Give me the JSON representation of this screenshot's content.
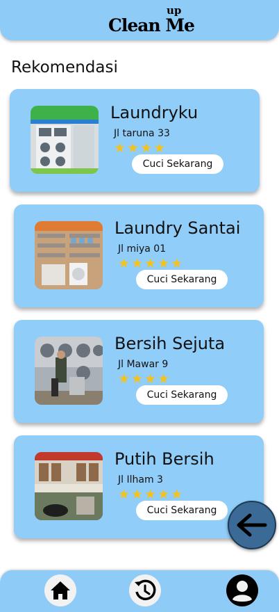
{
  "header": {
    "logo_main": "Clean Me",
    "logo_sup": "up"
  },
  "section_title": "Rekomendasi",
  "cta_label": "Cuci Sekarang",
  "colors": {
    "card": "#90cdf8",
    "header": "#8ecbf7",
    "star": "#f3c21f",
    "fab": "#3a6a95"
  },
  "laundries": [
    {
      "name": "Laundryku",
      "address": "Jl taruna 33",
      "rating": 4,
      "stars": "★★★★"
    },
    {
      "name": "Laundry Santai",
      "address": "Jl miya 01",
      "rating": 5,
      "stars": "★★★★★"
    },
    {
      "name": "Bersih Sejuta",
      "address": "Jl Mawar 9",
      "rating": 4,
      "stars": "★★★★"
    },
    {
      "name": "Putih Bersih",
      "address": "Jl Ilham 3",
      "rating": 5,
      "stars": "★★★★★"
    }
  ],
  "bottom_nav": {
    "items": [
      "home-icon",
      "history-icon",
      "profile-icon"
    ],
    "active": "none"
  },
  "fab_icon": "arrow-left-icon"
}
